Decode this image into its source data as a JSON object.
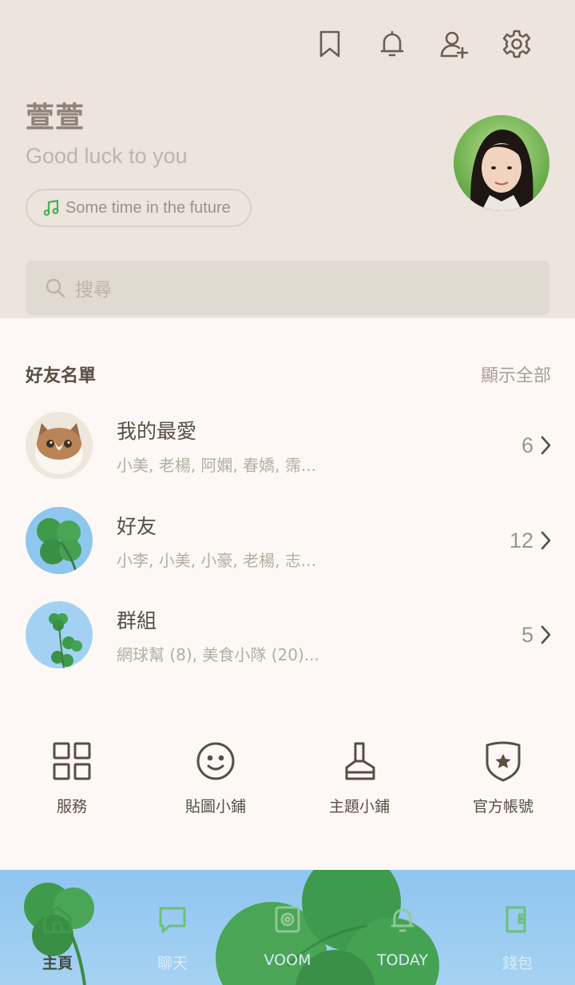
{
  "profile": {
    "name": "萱萱",
    "status": "Good luck to you",
    "music": "Some time in the future"
  },
  "top_icons": [
    "bookmark-icon",
    "bell-icon",
    "add-friend-icon",
    "gear-icon"
  ],
  "search": {
    "placeholder": "搜尋"
  },
  "friends": {
    "title": "好友名單",
    "show_all": "顯示全部",
    "groups": [
      {
        "name": "我的最愛",
        "members": "小美, 老楊, 阿嫻, 春嬌, 霈...",
        "count": "6"
      },
      {
        "name": "好友",
        "members": "小李, 小美, 小豪, 老楊, 志...",
        "count": "12"
      },
      {
        "name": "群組",
        "members": "網球幫 (8), 美食小隊 (20)...",
        "count": "5"
      }
    ]
  },
  "shortcuts": [
    {
      "label": "服務",
      "icon": "grid-icon"
    },
    {
      "label": "貼圖小鋪",
      "icon": "smiley-icon"
    },
    {
      "label": "主題小鋪",
      "icon": "brush-icon"
    },
    {
      "label": "官方帳號",
      "icon": "shield-star-icon"
    }
  ],
  "bottom_nav": [
    {
      "label": "主頁",
      "icon": "home-icon",
      "active": true
    },
    {
      "label": "聊天",
      "icon": "chat-icon",
      "active": false
    },
    {
      "label": "VOOM",
      "icon": "voom-icon",
      "active": false
    },
    {
      "label": "TODAY",
      "icon": "today-icon",
      "active": false
    },
    {
      "label": "錢包",
      "icon": "wallet-icon",
      "active": false
    }
  ],
  "colors": {
    "header_bg": "#ece4dd",
    "body_bg": "#fdf8f5",
    "text_primary": "#5a4d44",
    "music_note": "#4caf50",
    "nav_bg": "#8fc5f0"
  }
}
